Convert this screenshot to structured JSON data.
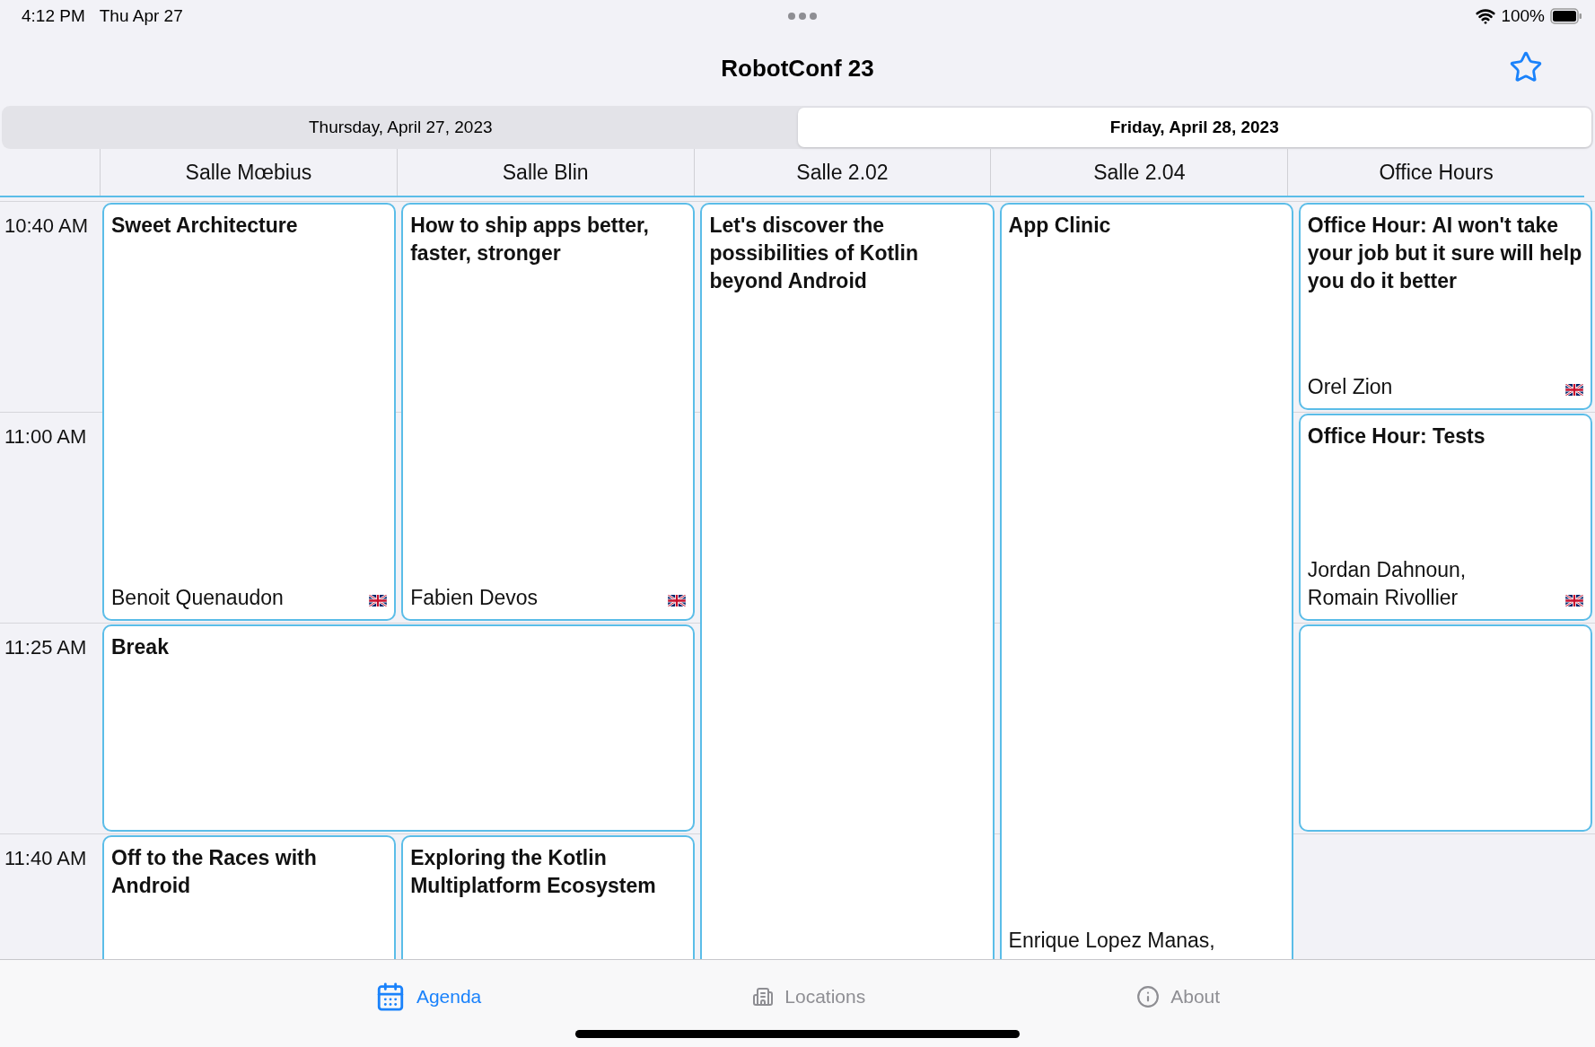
{
  "status_bar": {
    "time": "4:12 PM",
    "date": "Thu Apr 27",
    "battery": "100%"
  },
  "nav": {
    "title": "RobotConf 23"
  },
  "days": [
    {
      "label": "Thursday, April 27, 2023",
      "selected": false
    },
    {
      "label": "Friday, April 28, 2023",
      "selected": true
    }
  ],
  "rooms": [
    "Salle Mœbius",
    "Salle Blin",
    "Salle 2.02",
    "Salle 2.04",
    "Office Hours"
  ],
  "times": [
    "10:40 AM",
    "11:00 AM",
    "11:25 AM",
    "11:40 AM"
  ],
  "sessions": [
    {
      "title": "Sweet Architecture",
      "speakers": [
        "Benoit Quenaudon"
      ],
      "flag": true
    },
    {
      "title": "How to ship apps better, faster, stronger",
      "speakers": [
        "Fabien Devos"
      ],
      "flag": true
    },
    {
      "title": "Let's discover the possibilities of Kotlin beyond Android"
    },
    {
      "title": "App Clinic",
      "speakers": [
        "Enrique Lopez Manas,"
      ]
    },
    {
      "title": "Office Hour: AI won't take your job but it sure will help you do it better",
      "speakers": [
        "Orel Zion"
      ],
      "flag": true
    },
    {
      "title": "Office Hour: Tests",
      "speakers": [
        "Jordan Dahnoun,",
        "Romain Rivollier"
      ],
      "flag": true
    },
    {
      "title": "Break"
    },
    {
      "title": "Off to the Races with Android"
    },
    {
      "title": "Exploring the Kotlin Multiplatform Ecosystem"
    }
  ],
  "tab_bar": [
    {
      "kind": "agenda",
      "label": "Agenda",
      "selected": true
    },
    {
      "kind": "locations",
      "label": "Locations",
      "selected": false
    },
    {
      "kind": "about",
      "label": "About",
      "selected": false
    }
  ]
}
